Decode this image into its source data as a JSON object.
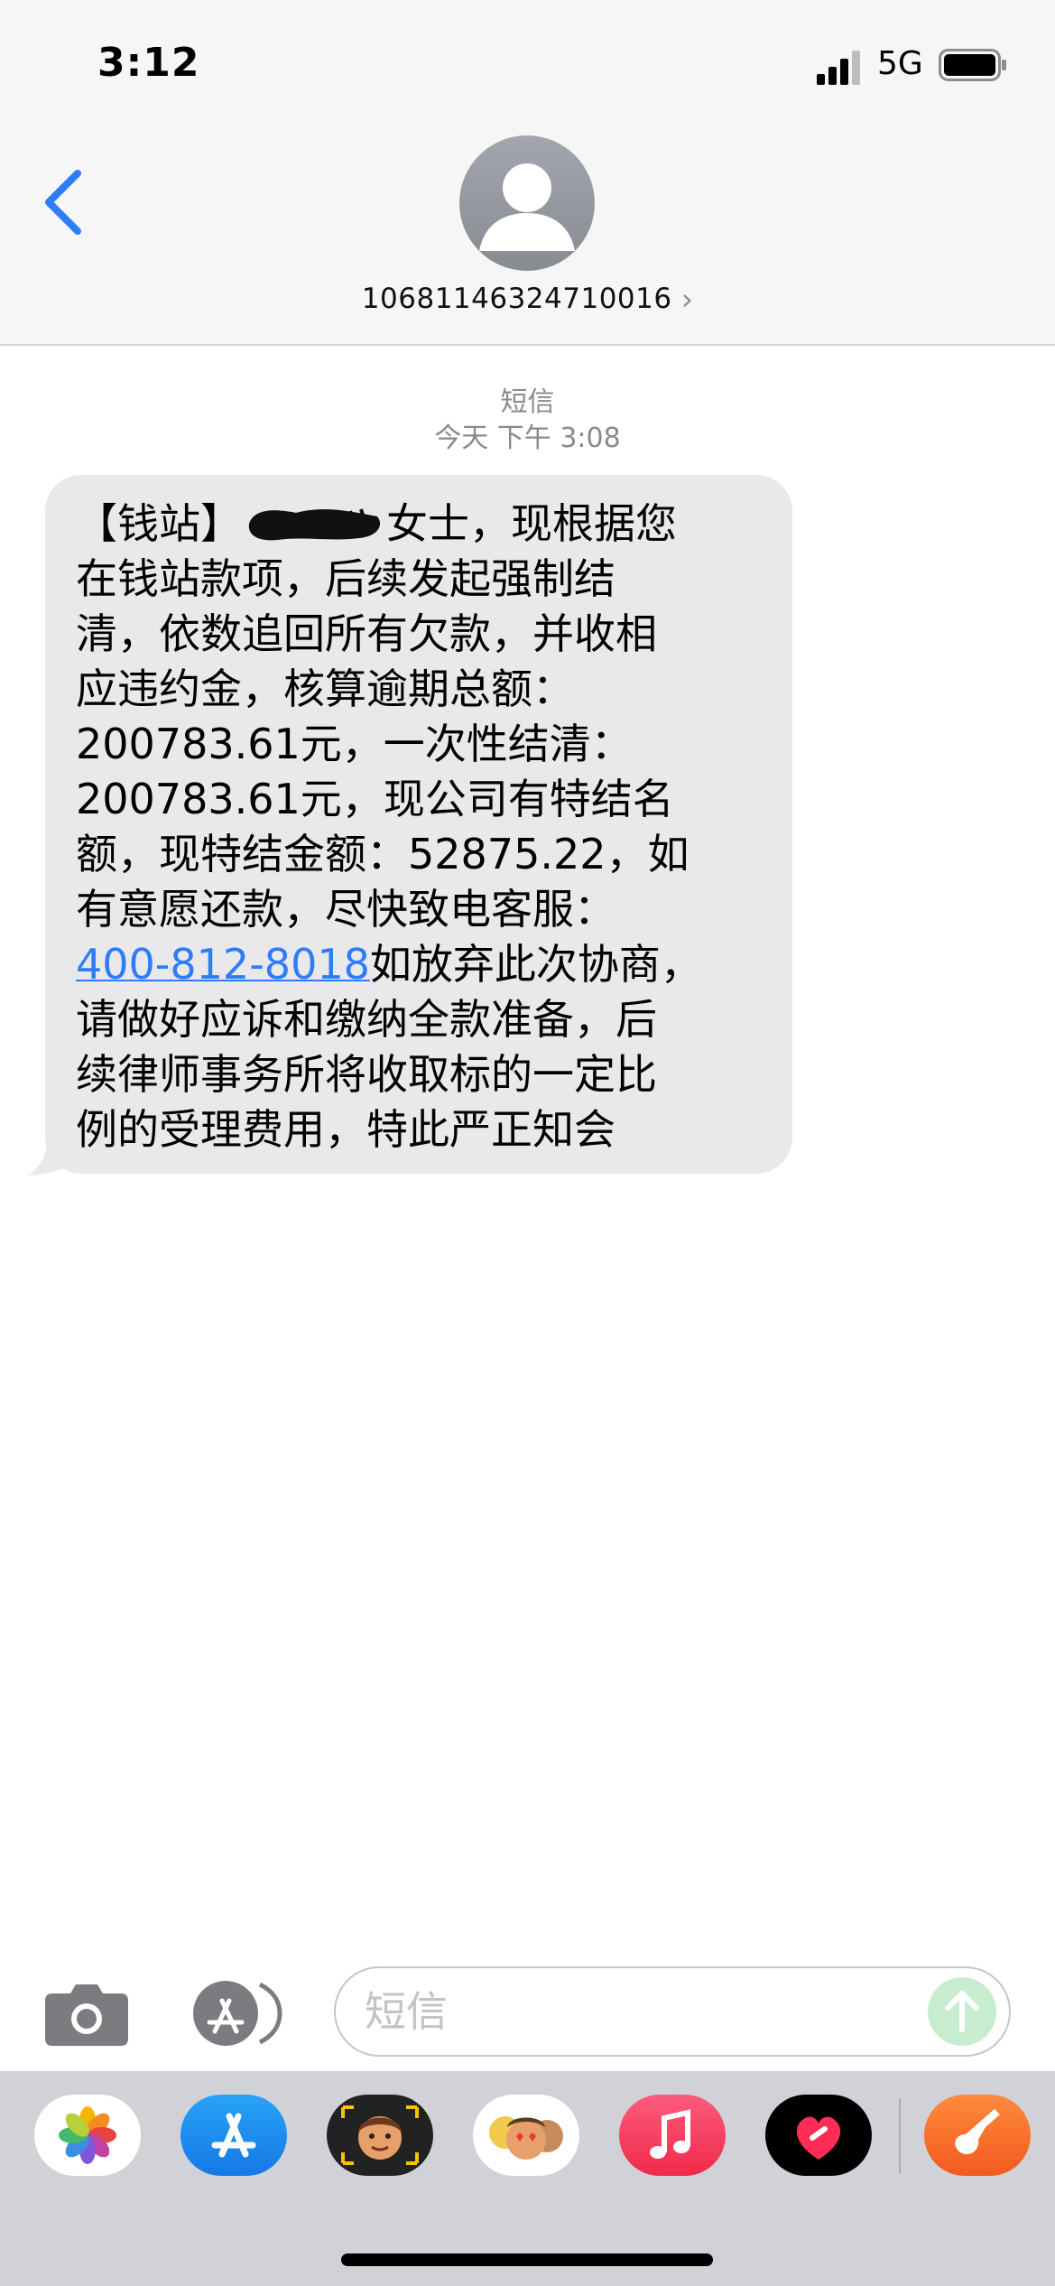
{
  "status_bar": {
    "time": "3:12",
    "network": "5G",
    "icons": [
      "cellular-signal-icon",
      "battery-icon"
    ]
  },
  "header": {
    "back_icon": "chevron-left-icon",
    "avatar_icon": "person-placeholder-icon",
    "contact_number": "10681146324710016",
    "contact_chevron": "›"
  },
  "conversation": {
    "service_label": "短信",
    "timestamp": "今天 下午 3:08",
    "message": {
      "line1_prefix": "【钱站】",
      "line1_suffix": "女士，现根据您",
      "line2": "在钱站款项，后续发起强制结",
      "line3": "清，依数追回所有欠款，并收相",
      "line4": "应违约金，核算逾期总额：",
      "line5": "200783.61元，一次性结清：",
      "line6": "200783.61元，现公司有特结名",
      "line7": "额，现特结金额：52875.22，如",
      "line8": "有意愿还款，尽快致电客服：",
      "phone_link": "400-812-8018",
      "line9_suffix": "如放弃此次协商，",
      "line10": "请做好应诉和缴纳全款准备，后",
      "line11": "续律师事务所将收取标的一定比",
      "line12": "例的受理费用，特此严正知会"
    }
  },
  "compose": {
    "placeholder": "短信",
    "camera_icon": "camera-icon",
    "apps_icon": "app-store-icon",
    "send_icon": "arrow-up-icon"
  },
  "app_drawer": {
    "apps": [
      "photos-icon",
      "app-store-icon",
      "memoji-icon",
      "memoji-stickers-icon",
      "music-icon",
      "fitness-heart-icon",
      "garageband-icon"
    ]
  },
  "colors": {
    "link": "#2f7df6",
    "bubble": "#e9e9eb",
    "back_chevron": "#2f7df6",
    "send_disabled": "#c8ecd0"
  }
}
